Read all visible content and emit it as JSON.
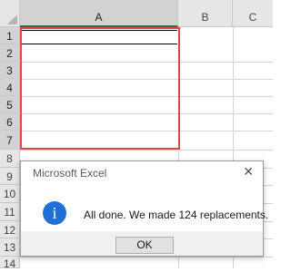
{
  "spreadsheet": {
    "columns": [
      "A",
      "B",
      "C"
    ],
    "rows": [
      "1",
      "2",
      "3",
      "4",
      "5",
      "6",
      "7",
      "8",
      "9",
      "10",
      "11",
      "12",
      "13",
      "14"
    ]
  },
  "dialog": {
    "title": "Microsoft Excel",
    "close_glyph": "✕",
    "icon_glyph": "i",
    "message": "All done. We made 124 replacements.",
    "ok_label": "OK"
  },
  "colors": {
    "highlight_border": "#e04848",
    "info_icon": "#1f6fd6",
    "selection_accent": "#217346"
  }
}
